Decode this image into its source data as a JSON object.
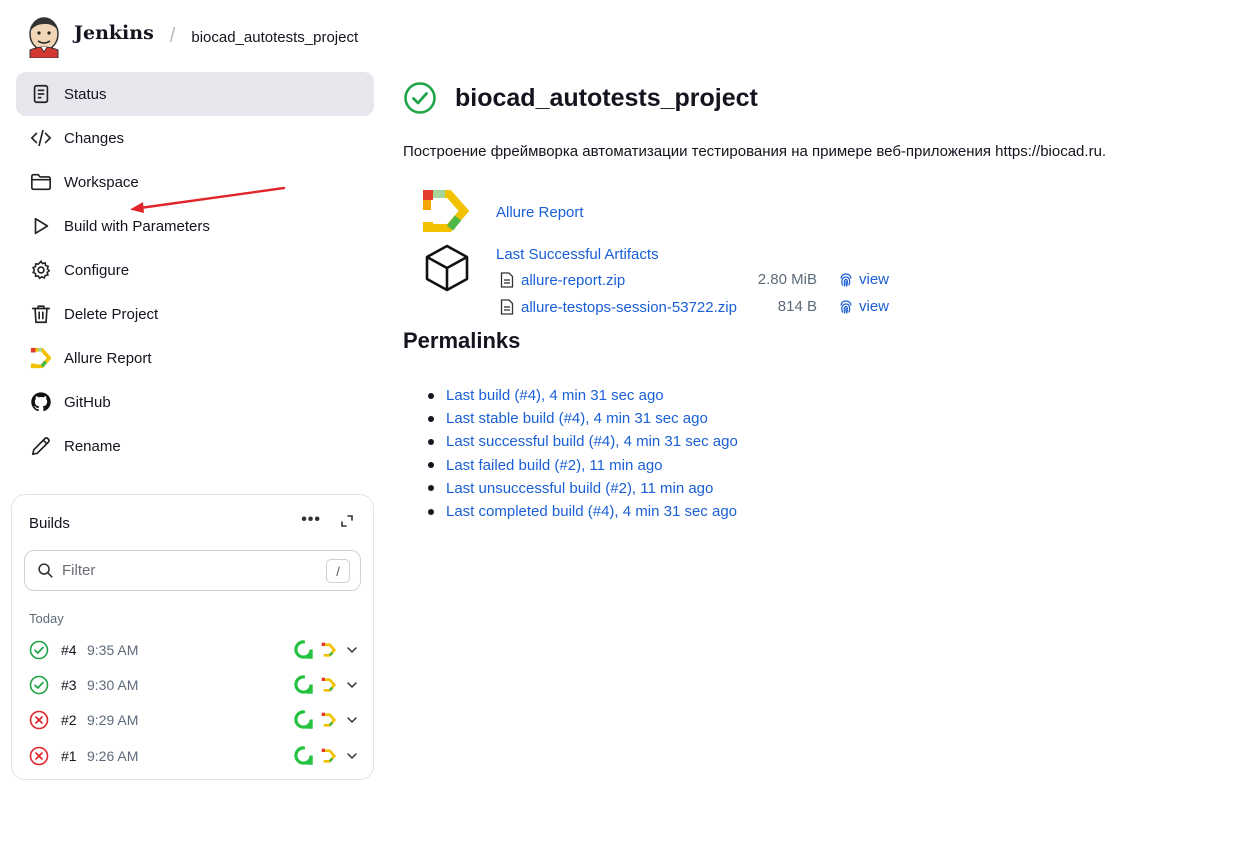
{
  "header": {
    "brand": "Jenkins",
    "breadcrumb_project": "biocad_autotests_project"
  },
  "sidebar": {
    "items": [
      {
        "label": "Status",
        "icon": "document-icon",
        "active": true
      },
      {
        "label": "Changes",
        "icon": "code-icon"
      },
      {
        "label": "Workspace",
        "icon": "folder-icon"
      },
      {
        "label": "Build with Parameters",
        "icon": "play-icon"
      },
      {
        "label": "Configure",
        "icon": "gear-icon"
      },
      {
        "label": "Delete Project",
        "icon": "trash-icon"
      },
      {
        "label": "Allure Report",
        "icon": "allure-icon"
      },
      {
        "label": "GitHub",
        "icon": "github-icon"
      },
      {
        "label": "Rename",
        "icon": "pencil-icon"
      }
    ]
  },
  "builds": {
    "title": "Builds",
    "filter_placeholder": "Filter",
    "filter_shortcut": "/",
    "group_label": "Today",
    "rows": [
      {
        "number": "#4",
        "time": "9:35 AM",
        "status": "success"
      },
      {
        "number": "#3",
        "time": "9:30 AM",
        "status": "success"
      },
      {
        "number": "#2",
        "time": "9:29 AM",
        "status": "failed"
      },
      {
        "number": "#1",
        "time": "9:26 AM",
        "status": "failed"
      }
    ]
  },
  "main": {
    "title": "biocad_autotests_project",
    "description": "Построение фреймворка автоматизации тестирования на примере веб-приложения https://biocad.ru.",
    "allure_link": "Allure Report",
    "artifacts_title": "Last Successful Artifacts",
    "artifacts": [
      {
        "name": "allure-report.zip",
        "size": "2.80 MiB",
        "action": "view"
      },
      {
        "name": "allure-testops-session-53722.zip",
        "size": "814 B",
        "action": "view"
      }
    ],
    "permalinks_title": "Permalinks",
    "permalinks": [
      "Last build (#4), 4 min 31 sec ago",
      "Last stable build (#4), 4 min 31 sec ago",
      "Last successful build (#4), 4 min 31 sec ago",
      "Last failed build (#2), 11 min ago",
      "Last unsuccessful build (#2), 11 min ago",
      "Last completed build (#4), 4 min 31 sec ago"
    ]
  },
  "colors": {
    "link": "#1a5fd6",
    "success": "#1ea446",
    "failure": "#e0262b",
    "active_bg": "#e6e7ec",
    "annotation_arrow": "#e0262b"
  }
}
